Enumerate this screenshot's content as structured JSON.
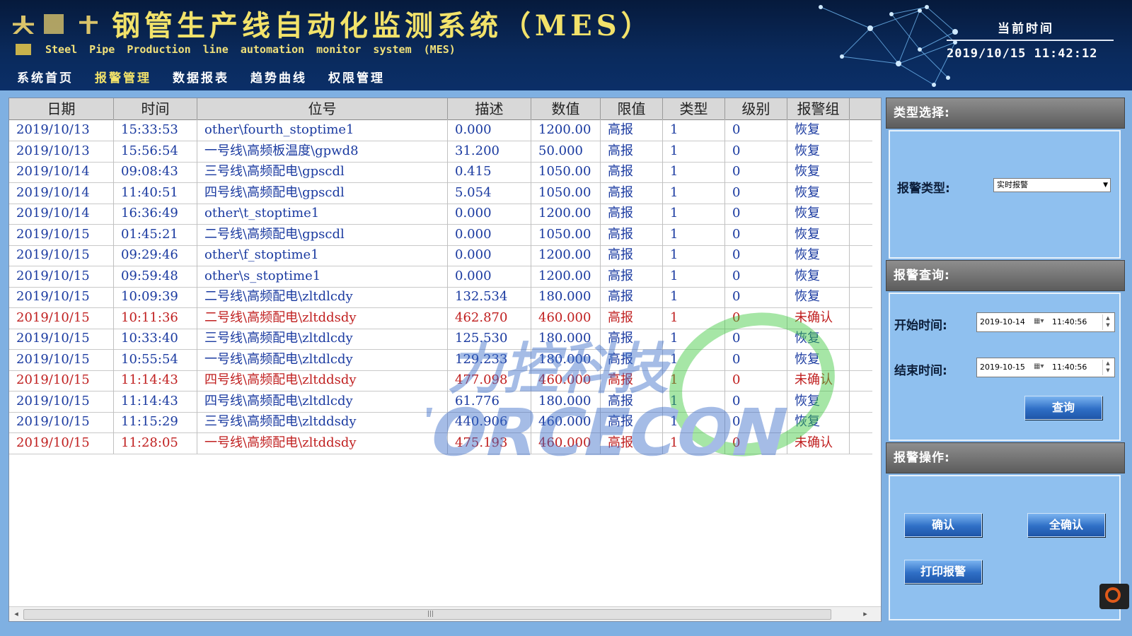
{
  "header": {
    "logo_text": "大 ■ 东",
    "title_cn": "钢管生产线自动化监测系统（MES）",
    "title_en": "Steel Pipe Production line automation monitor system (MES)",
    "nav": [
      {
        "label": "系统首页",
        "active": false
      },
      {
        "label": "报警管理",
        "active": true
      },
      {
        "label": "数据报表",
        "active": false
      },
      {
        "label": "趋势曲线",
        "active": false
      },
      {
        "label": "权限管理",
        "active": false
      }
    ],
    "clock_label": "当前时间",
    "clock_value": "2019/10/15  11:42:12"
  },
  "table": {
    "columns": [
      "日期",
      "时间",
      "位号",
      "描述",
      "数值",
      "限值",
      "类型",
      "级别",
      "报警组"
    ],
    "rows": [
      {
        "date": "2019/10/13",
        "time": "15:33:53",
        "tag": "other\\fourth_stoptime1",
        "desc": "0.000",
        "value": "1200.00",
        "limit": "高报",
        "type": "1",
        "level": "0",
        "group": "恢复",
        "alarm": false
      },
      {
        "date": "2019/10/13",
        "time": "15:56:54",
        "tag": "一号线\\高频板温度\\gpwd8",
        "desc": "31.200",
        "value": "50.000",
        "limit": "高报",
        "type": "1",
        "level": "0",
        "group": "恢复",
        "alarm": false
      },
      {
        "date": "2019/10/14",
        "time": "09:08:43",
        "tag": "三号线\\高频配电\\gpscdl",
        "desc": "0.415",
        "value": "1050.00",
        "limit": "高报",
        "type": "1",
        "level": "0",
        "group": "恢复",
        "alarm": false
      },
      {
        "date": "2019/10/14",
        "time": "11:40:51",
        "tag": "四号线\\高频配电\\gpscdl",
        "desc": "5.054",
        "value": "1050.00",
        "limit": "高报",
        "type": "1",
        "level": "0",
        "group": "恢复",
        "alarm": false
      },
      {
        "date": "2019/10/14",
        "time": "16:36:49",
        "tag": "other\\t_stoptime1",
        "desc": "0.000",
        "value": "1200.00",
        "limit": "高报",
        "type": "1",
        "level": "0",
        "group": "恢复",
        "alarm": false
      },
      {
        "date": "2019/10/15",
        "time": "01:45:21",
        "tag": "二号线\\高频配电\\gpscdl",
        "desc": "0.000",
        "value": "1050.00",
        "limit": "高报",
        "type": "1",
        "level": "0",
        "group": "恢复",
        "alarm": false
      },
      {
        "date": "2019/10/15",
        "time": "09:29:46",
        "tag": "other\\f_stoptime1",
        "desc": "0.000",
        "value": "1200.00",
        "limit": "高报",
        "type": "1",
        "level": "0",
        "group": "恢复",
        "alarm": false
      },
      {
        "date": "2019/10/15",
        "time": "09:59:48",
        "tag": "other\\s_stoptime1",
        "desc": "0.000",
        "value": "1200.00",
        "limit": "高报",
        "type": "1",
        "level": "0",
        "group": "恢复",
        "alarm": false
      },
      {
        "date": "2019/10/15",
        "time": "10:09:39",
        "tag": "二号线\\高频配电\\zltdlcdy",
        "desc": "132.534",
        "value": "180.000",
        "limit": "高报",
        "type": "1",
        "level": "0",
        "group": "恢复",
        "alarm": false
      },
      {
        "date": "2019/10/15",
        "time": "10:11:36",
        "tag": "二号线\\高频配电\\zltddsdy",
        "desc": "462.870",
        "value": "460.000",
        "limit": "高报",
        "type": "1",
        "level": "0",
        "group": "未确认",
        "alarm": true
      },
      {
        "date": "2019/10/15",
        "time": "10:33:40",
        "tag": "三号线\\高频配电\\zltdlcdy",
        "desc": "125.530",
        "value": "180.000",
        "limit": "高报",
        "type": "1",
        "level": "0",
        "group": "恢复",
        "alarm": false
      },
      {
        "date": "2019/10/15",
        "time": "10:55:54",
        "tag": "一号线\\高频配电\\zltdlcdy",
        "desc": "129.233",
        "value": "180.000",
        "limit": "高报",
        "type": "1",
        "level": "0",
        "group": "恢复",
        "alarm": false
      },
      {
        "date": "2019/10/15",
        "time": "11:14:43",
        "tag": "四号线\\高频配电\\zltddsdy",
        "desc": "477.098",
        "value": "460.000",
        "limit": "高报",
        "type": "1",
        "level": "0",
        "group": "未确认",
        "alarm": true
      },
      {
        "date": "2019/10/15",
        "time": "11:14:43",
        "tag": "四号线\\高频配电\\zltdlcdy",
        "desc": "61.776",
        "value": "180.000",
        "limit": "高报",
        "type": "1",
        "level": "0",
        "group": "恢复",
        "alarm": false
      },
      {
        "date": "2019/10/15",
        "time": "11:15:29",
        "tag": "三号线\\高频配电\\zltddsdy",
        "desc": "440.906",
        "value": "460.000",
        "limit": "高报",
        "type": "1",
        "level": "0",
        "group": "恢复",
        "alarm": false
      },
      {
        "date": "2019/10/15",
        "time": "11:28:05",
        "tag": "一号线\\高频配电\\zltddsdy",
        "desc": "475.193",
        "value": "460.000",
        "limit": "高报",
        "type": "1",
        "level": "0",
        "group": "未确认",
        "alarm": true
      }
    ]
  },
  "watermark": {
    "cn": "力控科技",
    "en": "FORCECON"
  },
  "side": {
    "type_section": {
      "title": "类型选择:",
      "type_label": "报警类型:",
      "type_value": "实时报警"
    },
    "query_section": {
      "title": "报警查询:",
      "start_label": "开始时间:",
      "start_date": "2019-10-14",
      "start_time": "11:40:56",
      "end_label": "结束时间:",
      "end_date": "2019-10-15",
      "end_time": "11:40:56",
      "query_button": "查询"
    },
    "op_section": {
      "title": "报警操作:",
      "confirm_button": "确认",
      "confirm_all_button": "全确认",
      "print_button": "打印报警"
    }
  },
  "colors": {
    "normal_text": "#1a3aa0",
    "alarm_text": "#c02020",
    "title_yellow": "#f2e26a"
  }
}
